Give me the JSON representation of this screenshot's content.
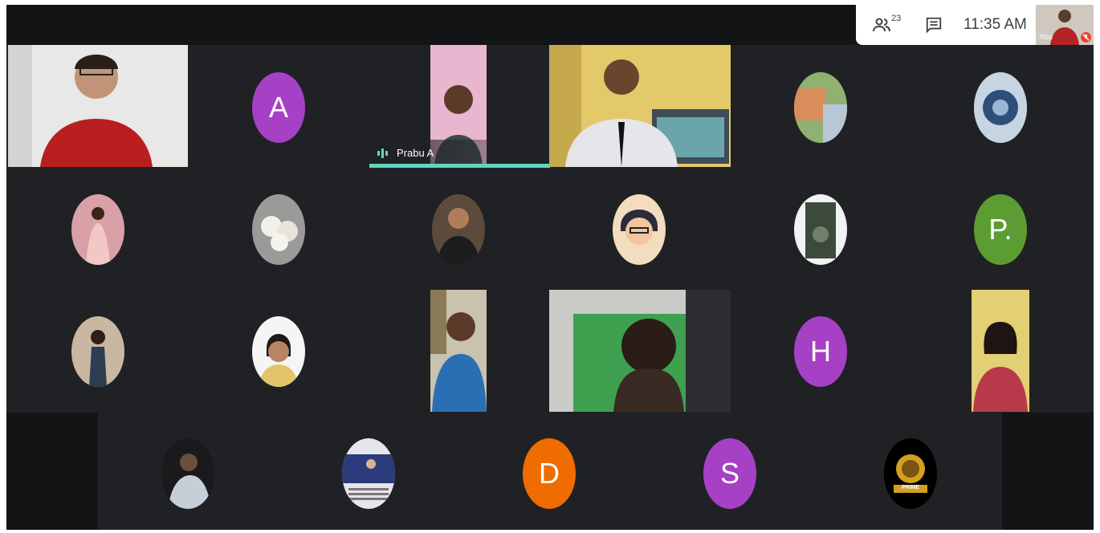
{
  "header": {
    "participants_count": "23",
    "time": "11:35 AM",
    "self_label": "You",
    "icons": [
      "people-icon",
      "chat-icon",
      "mic-off-icon"
    ]
  },
  "colors": {
    "background": "#202124",
    "speaking_bar": "#5ed6c1",
    "avatar_purple": "#a641c5",
    "avatar_green": "#5c9d33",
    "avatar_orange": "#ef6c00"
  },
  "speaker": {
    "name": "Prabu A"
  },
  "avatars": {
    "a": "A",
    "p": "P.",
    "h": "H",
    "d": "D",
    "s": "S"
  },
  "logo_text": "PRIME"
}
